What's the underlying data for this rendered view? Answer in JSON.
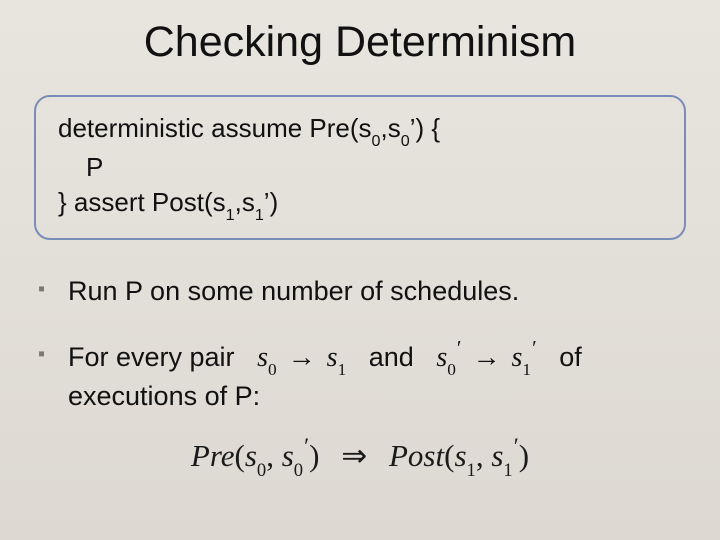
{
  "title": "Checking Determinism",
  "code": {
    "line1_pre": "deterministic assume Pre(s",
    "line1_sub0a": "0",
    "line1_mid1": ",s",
    "line1_sub0b": "0",
    "line1_post": "’) {",
    "line2": "P",
    "line3_pre": "} assert Post(s",
    "line3_sub1a": "1",
    "line3_mid1": ",s",
    "line3_sub1b": "1",
    "line3_post": "’)"
  },
  "bullets": {
    "b1": "Run P on some number of schedules.",
    "b2_a": "For every pair   ",
    "b2_and": "   and   ",
    "b2_of": "   of",
    "b2_line2": "executions of P:"
  },
  "math": {
    "s": "s",
    "sub0": "0",
    "sub1": "1",
    "arrow": "→",
    "prime": "′",
    "Pre": "Pre",
    "Post": "Post",
    "implies": "⇒"
  }
}
